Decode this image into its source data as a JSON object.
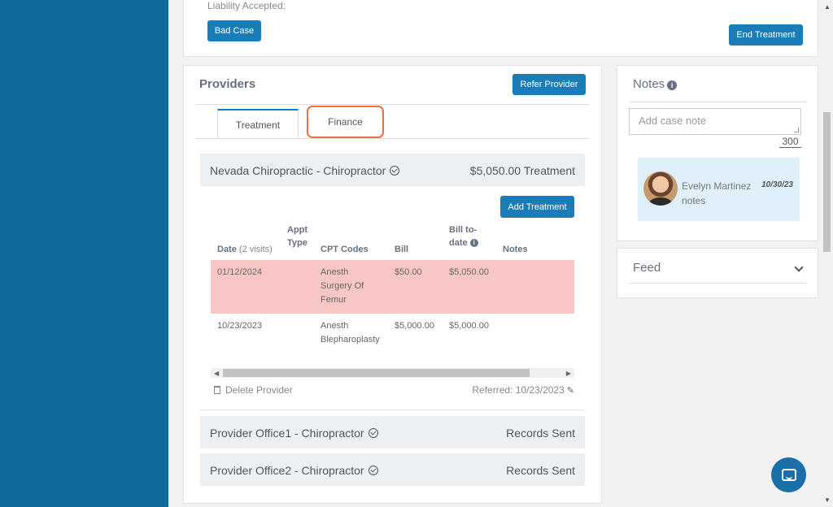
{
  "top": {
    "liability_label": "Liability Accepted:",
    "bad_case_label": "Bad Case",
    "end_treatment_label": "End Treatment"
  },
  "providers": {
    "title": "Providers",
    "refer_label": "Refer Provider",
    "tabs": [
      {
        "label": "Treatment"
      },
      {
        "label": "Finance"
      }
    ],
    "list": [
      {
        "name": "Nevada Chiropractic - Chiropractor",
        "status": "$5,050.00 Treatment"
      },
      {
        "name": "Provider Office1 - Chiropractor",
        "status": "Records Sent"
      },
      {
        "name": "Provider Office2 - Chiropractor",
        "status": "Records Sent"
      }
    ],
    "add_treatment_label": "Add Treatment",
    "table": {
      "headers": {
        "date": "Date",
        "visits": "(2 visits)",
        "appt_type_1": "Appt",
        "appt_type_2": "Type",
        "cpt": "CPT Codes",
        "bill": "Bill",
        "bill_to_date_1": "Bill to-",
        "bill_to_date_2": "date",
        "notes": "Notes"
      },
      "rows": [
        {
          "date": "01/12/2024",
          "cpt_1": "Anesth",
          "cpt_2": "Surgery Of",
          "cpt_3": "Femur",
          "bill": "$50.00",
          "bill_to_date": "$5,050.00"
        },
        {
          "date": "10/23/2023",
          "cpt_1": "Anesth",
          "cpt_2": "Blepharoplasty",
          "bill": "$5,000.00",
          "bill_to_date": "$5,000.00"
        }
      ]
    },
    "delete_label": "Delete Provider",
    "referred_label": "Referred: 10/23/2023"
  },
  "notes": {
    "title": "Notes",
    "placeholder": "Add case note",
    "char_count": "300",
    "items": [
      {
        "author": "Evelyn Martinez",
        "text": "notes",
        "date": "10/30/23"
      }
    ]
  },
  "feed": {
    "title": "Feed"
  },
  "colors": {
    "sidebar": "#0e6a9c",
    "primary": "#1b7db8",
    "highlight_row": "#f9c6c6",
    "finance_outline": "#e8713c"
  }
}
